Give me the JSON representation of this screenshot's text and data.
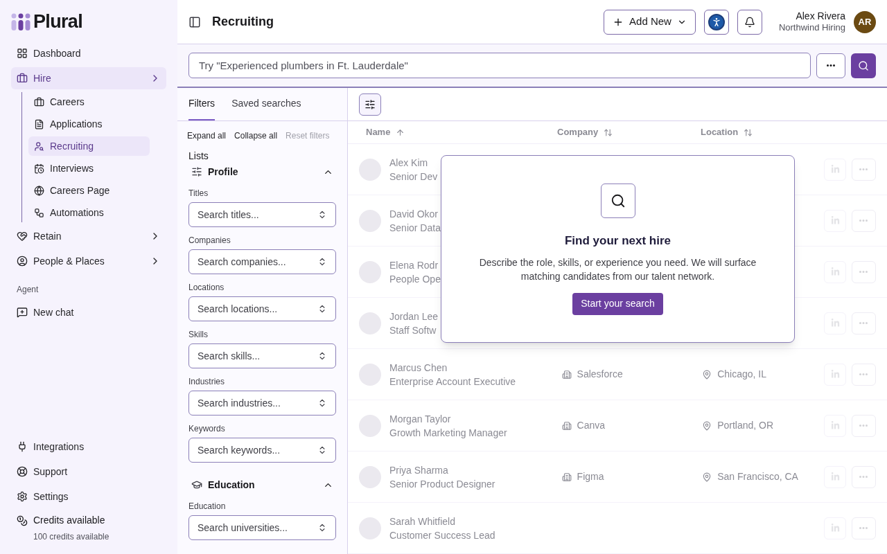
{
  "sidebar": {
    "logo": "Plural",
    "nav": [
      {
        "label": "Dashboard",
        "selected": false,
        "has_submenu": false
      },
      {
        "label": "Hire",
        "selected": true,
        "has_submenu": true,
        "children": [
          {
            "label": "Careers",
            "selected": false
          },
          {
            "label": "Applications",
            "selected": false
          },
          {
            "label": "Recruiting",
            "selected": true
          },
          {
            "label": "Interviews",
            "selected": false
          },
          {
            "label": "Careers Page",
            "selected": false
          },
          {
            "label": "Automations",
            "selected": false
          }
        ]
      },
      {
        "label": "Retain",
        "selected": false,
        "has_submenu": true
      },
      {
        "label": "People & Places",
        "selected": false,
        "has_submenu": true
      }
    ],
    "agent": {
      "heading": "Agent",
      "items": [
        {
          "label": "New chat",
          "selected": false
        }
      ]
    },
    "bottom": [
      {
        "label": "Integrations"
      },
      {
        "label": "Support"
      },
      {
        "label": "Settings"
      }
    ],
    "credits": {
      "label": "Credits available",
      "detail": "100 credits available"
    }
  },
  "header": {
    "title": "Recruiting",
    "add_button": "Add New",
    "user": {
      "name": "Alex Rivera",
      "org": "Northwind Hiring",
      "initials": "AR"
    }
  },
  "search": {
    "placeholder": "Try \"Experienced plumbers in Ft. Lauderdale\""
  },
  "filters": {
    "tabs": [
      {
        "label": "Filters",
        "selected": true
      },
      {
        "label": "Saved searches",
        "selected": false
      }
    ],
    "actions": [
      {
        "label": "Expand all",
        "disabled": false
      },
      {
        "label": "Collapse all",
        "disabled": false
      },
      {
        "label": "Reset filters",
        "disabled": true
      }
    ],
    "lists_label": "Lists",
    "sections": [
      {
        "title": "Profile",
        "expanded": true,
        "fields": [
          {
            "label": "Titles",
            "placeholder": "Search titles..."
          },
          {
            "label": "Companies",
            "placeholder": "Search companies..."
          },
          {
            "label": "Locations",
            "placeholder": "Search locations..."
          },
          {
            "label": "Skills",
            "placeholder": "Search skills..."
          },
          {
            "label": "Industries",
            "placeholder": "Search industries..."
          },
          {
            "label": "Keywords",
            "placeholder": "Search keywords..."
          }
        ]
      },
      {
        "title": "Education",
        "expanded": true,
        "fields": [
          {
            "label": "Education",
            "placeholder": "Search universities..."
          }
        ]
      }
    ]
  },
  "table": {
    "columns": [
      {
        "label": "Name",
        "sorted": true
      },
      {
        "label": "Company",
        "sorted": false
      },
      {
        "label": "Location",
        "sorted": false
      }
    ],
    "rows": [
      {
        "name": "Alex Kim",
        "title": "Senior Dev"
      },
      {
        "name": "David Okor",
        "title": "Senior Data"
      },
      {
        "name": "Elena Rodr",
        "title": "People Ope"
      },
      {
        "name": "Jordan Lee",
        "title": "Staff Softw"
      },
      {
        "name": "Marcus Chen",
        "title": "Enterprise Account Executive",
        "company": "Salesforce",
        "location": "Chicago, IL"
      },
      {
        "name": "Morgan Taylor",
        "title": "Growth Marketing Manager",
        "company": "Canva",
        "location": "Portland, OR"
      },
      {
        "name": "Priya Sharma",
        "title": "Senior Product Designer",
        "company": "Figma",
        "location": "San Francisco, CA"
      },
      {
        "name": "Sarah Whitfield",
        "title": "Customer Success Lead"
      }
    ]
  },
  "modal": {
    "title": "Find your next hire",
    "description": "Describe the role, skills, or experience you need. We will surface matching candidates from our talent network.",
    "button": "Start your search"
  }
}
